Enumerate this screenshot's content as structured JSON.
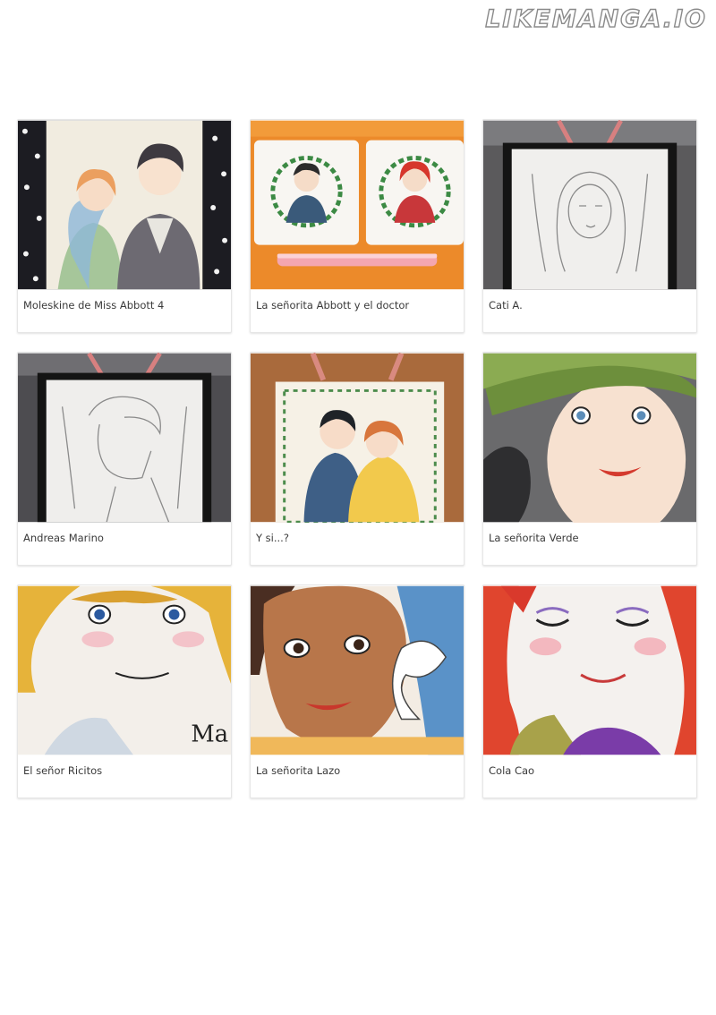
{
  "watermark": "LIKEMANGA.IO",
  "gallery": [
    {
      "title": "Moleskine de Miss Abbott 4",
      "thumbnail": "watercolor-couple-icon"
    },
    {
      "title": "La señorita Abbott y el doctor",
      "thumbnail": "framed-portraits-icon"
    },
    {
      "title": "Cati A.",
      "thumbnail": "pencil-girl-portrait-icon"
    },
    {
      "title": "Andreas Marino",
      "thumbnail": "pencil-man-profile-icon"
    },
    {
      "title": "Y si...?",
      "thumbnail": "couple-floral-frame-icon"
    },
    {
      "title": "La señorita Verde",
      "thumbnail": "green-hat-woman-icon"
    },
    {
      "title": "El señor Ricitos",
      "thumbnail": "curly-hair-man-icon"
    },
    {
      "title": "La señorita Lazo",
      "thumbnail": "bow-woman-icon"
    },
    {
      "title": "Cola Cao",
      "thumbnail": "red-hair-girl-icon"
    }
  ]
}
